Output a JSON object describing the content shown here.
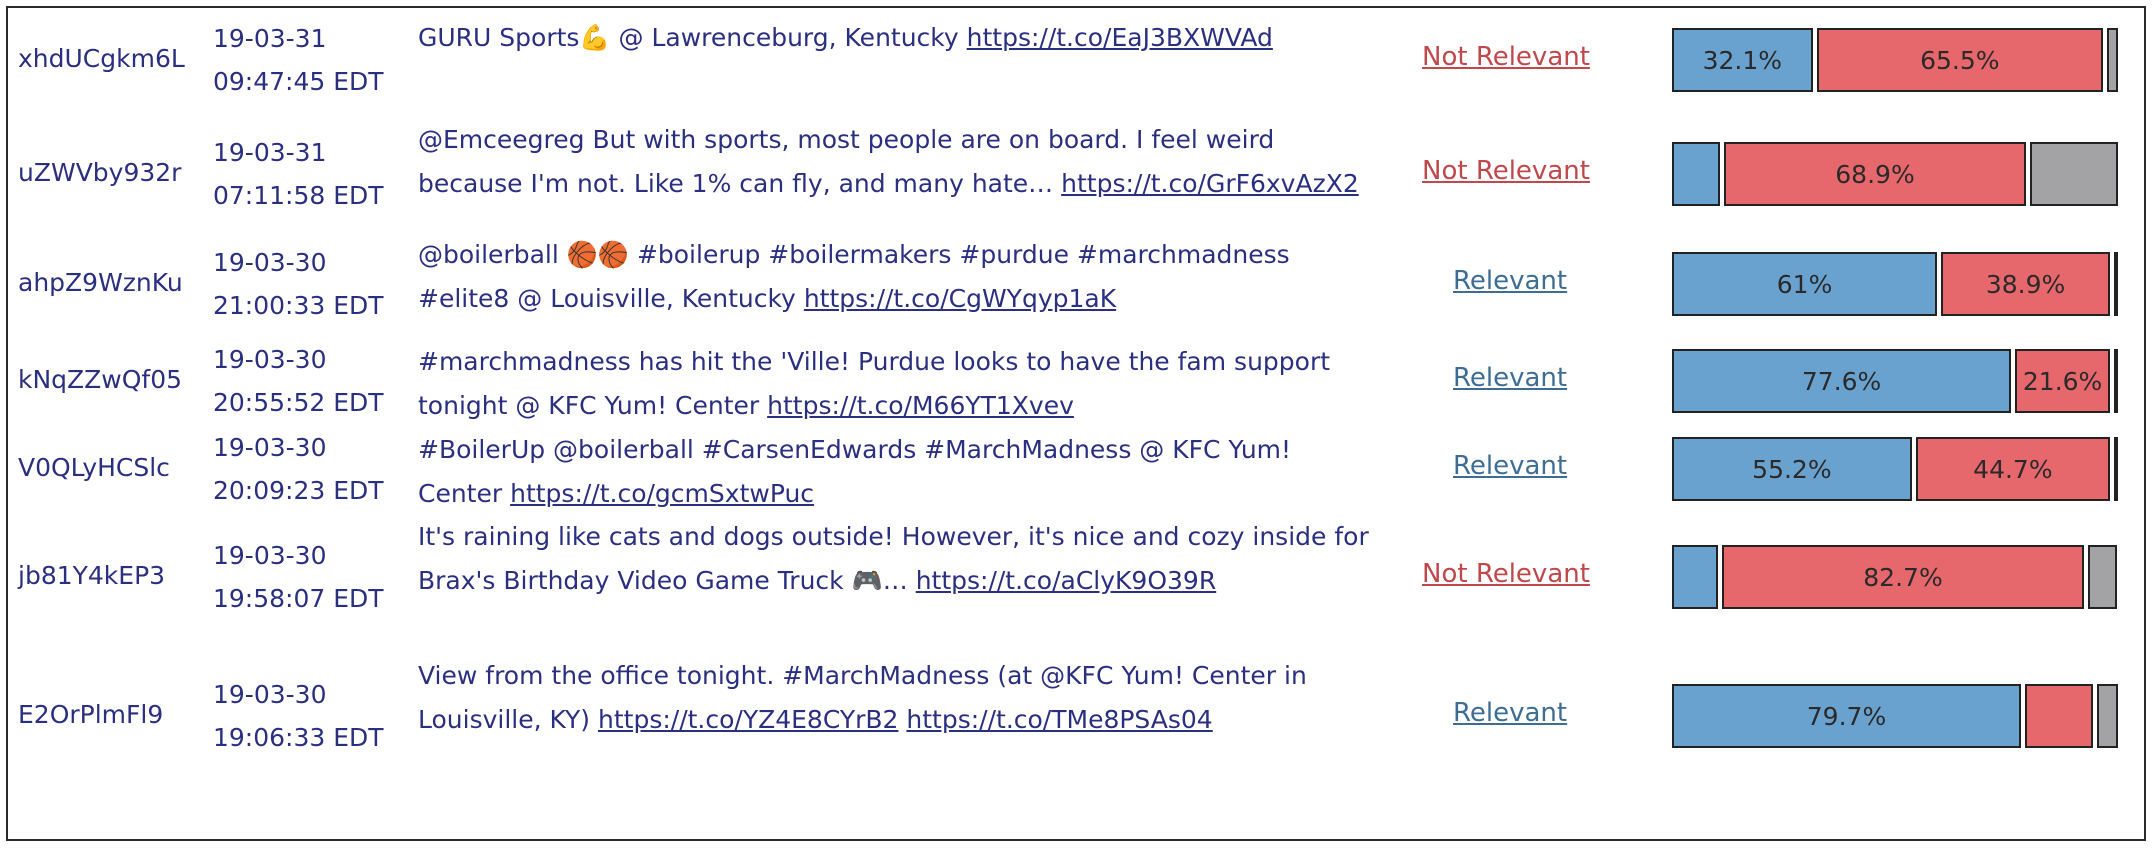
{
  "rows": [
    {
      "user": "xhdUCgkm6L",
      "date": "19-03-31",
      "time": "09:47:45 EDT",
      "text": "GURU Sports💪 @ Lawrenceburg, Kentucky",
      "link1": "https://t.co/EaJ3BXWVAd",
      "link2": "",
      "label": "Not Relevant",
      "relevant": false,
      "bar": {
        "relevant_pct": 32.1,
        "not_relevant_pct": 65.5,
        "other_pct": 2.4,
        "relevant_text": "32.1%",
        "not_relevant_text": "65.5%"
      }
    },
    {
      "user": "uZWVby932r",
      "date": "19-03-31",
      "time": "07:11:58 EDT",
      "text": "@Emceegreg But with sports, most people are on board. I feel weird because I'm not. Like 1% can fly, and many hate…",
      "link1": "https://t.co/GrF6xvAzX2",
      "link2": "",
      "label": "Not Relevant",
      "relevant": false,
      "bar": {
        "relevant_pct": 11.0,
        "not_relevant_pct": 68.9,
        "other_pct": 20.1,
        "relevant_text": "",
        "not_relevant_text": "68.9%"
      }
    },
    {
      "user": "ahpZ9WznKu",
      "date": "19-03-30",
      "time": "21:00:33 EDT",
      "text": "@boilerball 🏀🏀 #boilerup #boilermakers #purdue #marchmadness #elite8 @ Louisville, Kentucky",
      "link1": "https://t.co/CgWYqyp1aK",
      "link2": "",
      "label": "Relevant",
      "relevant": true,
      "bar": {
        "relevant_pct": 61,
        "not_relevant_pct": 38.9,
        "other_pct": 0.1,
        "relevant_text": "61%",
        "not_relevant_text": "38.9%"
      }
    },
    {
      "user": "kNqZZwQf05",
      "date": "19-03-30",
      "time": "20:55:52 EDT",
      "text": "#marchmadness has hit the 'Ville! Purdue looks to have the fam support tonight @ KFC Yum! Center",
      "link1": "https://t.co/M66YT1Xvev",
      "link2": "",
      "label": "Relevant",
      "relevant": true,
      "bar": {
        "relevant_pct": 77.6,
        "not_relevant_pct": 21.6,
        "other_pct": 0.8,
        "relevant_text": "77.6%",
        "not_relevant_text": "21.6%"
      }
    },
    {
      "user": "V0QLyHCSlc",
      "date": "19-03-30",
      "time": "20:09:23 EDT",
      "text": "#BoilerUp @boilerball #CarsenEdwards #MarchMadness @ KFC Yum! Center",
      "link1": "https://t.co/gcmSxtwPuc",
      "link2": "",
      "label": "Relevant",
      "relevant": true,
      "bar": {
        "relevant_pct": 55.2,
        "not_relevant_pct": 44.7,
        "other_pct": 0.1,
        "relevant_text": "55.2%",
        "not_relevant_text": "44.7%"
      }
    },
    {
      "user": "jb81Y4kEP3",
      "date": "19-03-30",
      "time": "19:58:07 EDT",
      "text": "It's raining like cats and dogs outside! However, it's nice and cozy inside for Brax's Birthday Video Game Truck 🎮…",
      "link1": "https://t.co/aClyK9O39R",
      "link2": "",
      "label": "Not Relevant",
      "relevant": false,
      "bar": {
        "relevant_pct": 10.6,
        "not_relevant_pct": 82.7,
        "other_pct": 6.7,
        "relevant_text": "",
        "not_relevant_text": "82.7%"
      }
    },
    {
      "user": "E2OrPlmFl9",
      "date": "19-03-30",
      "time": "19:06:33 EDT",
      "text": "View from the office tonight. #MarchMadness (at @KFC Yum! Center in Louisville, KY)",
      "link1": "https://t.co/YZ4E8CYrB2",
      "link2": "https://t.co/TMe8PSAs04",
      "label": "Relevant",
      "relevant": true,
      "bar": {
        "relevant_pct": 79.7,
        "not_relevant_pct": 15.6,
        "other_pct": 4.7,
        "relevant_text": "79.7%",
        "not_relevant_text": ""
      }
    }
  ],
  "colors": {
    "relevant": "#6aa2cf",
    "not_relevant": "#e6676c",
    "other": "#a3a3a6",
    "text": "#2b2f80",
    "relevant_label": "#3e6d93",
    "not_relevant_label": "#c0484b"
  }
}
